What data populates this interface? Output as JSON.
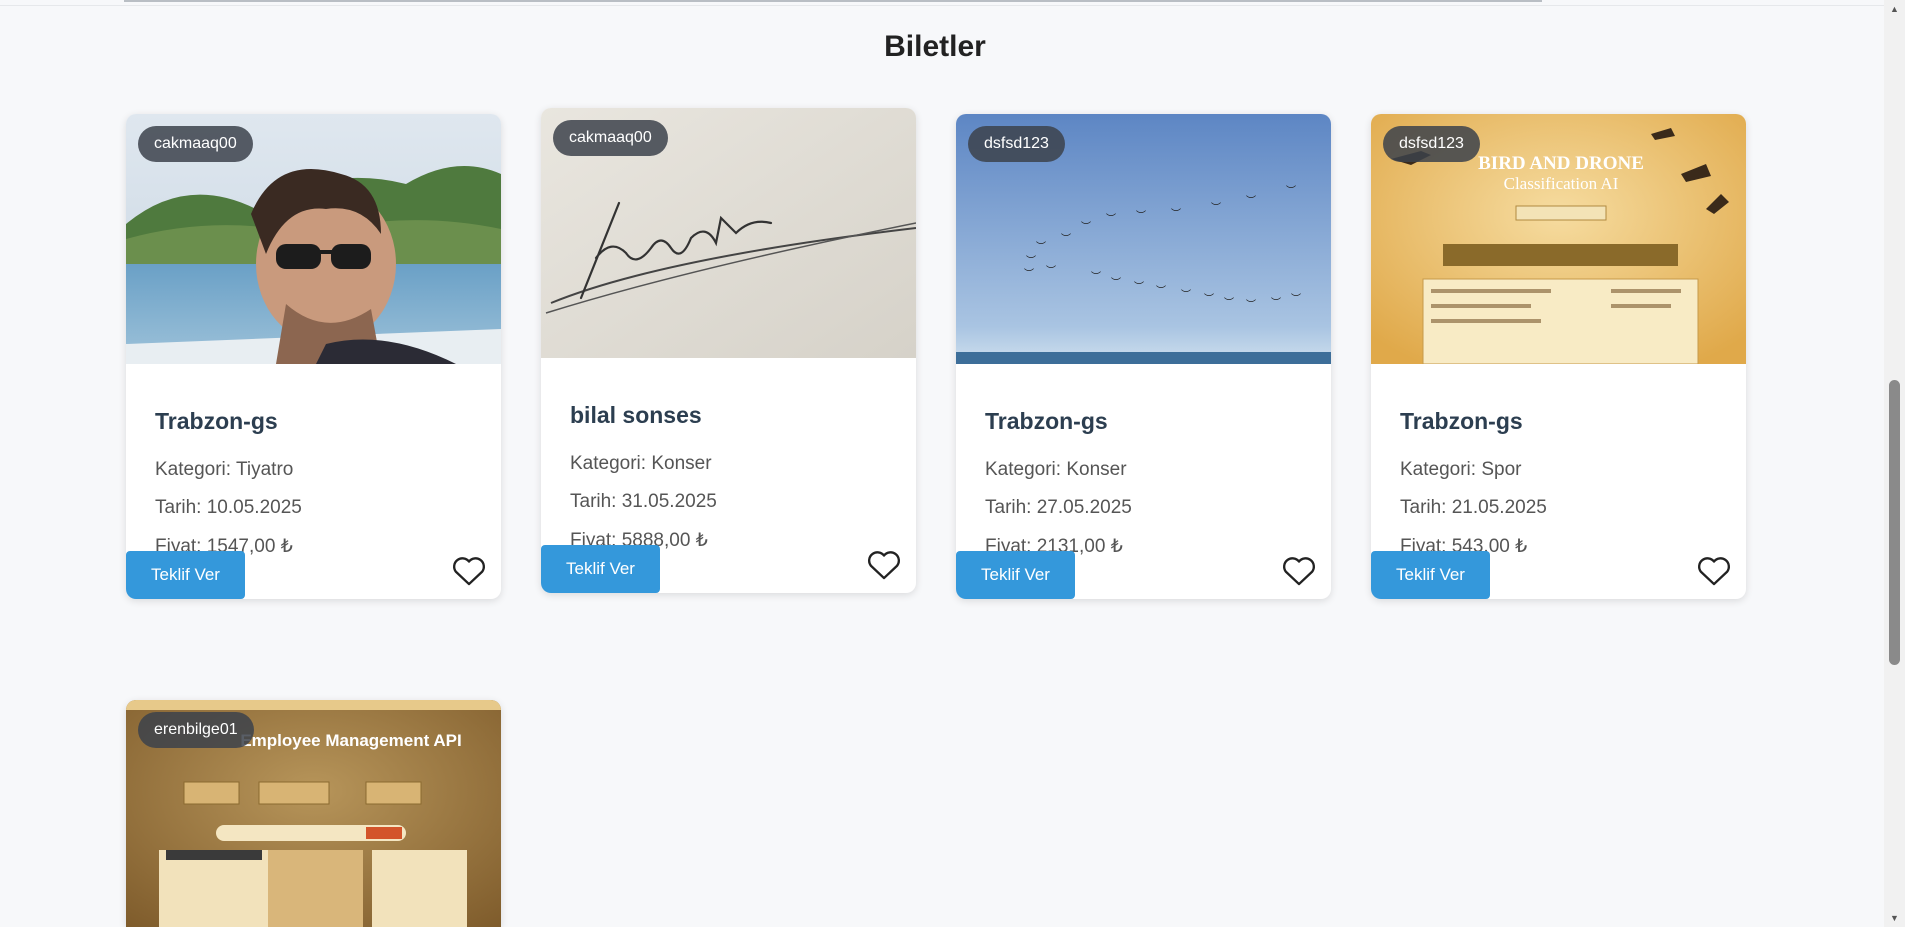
{
  "heading": "Biletler",
  "offer_label": "Teklif Ver",
  "tickets": [
    {
      "user": "cakmaaq00",
      "title": "Trabzon-gs",
      "category": "Kategori: Tiyatro",
      "date": "Tarih: 10.05.2025",
      "price": "Fiyat: 1547,00 ₺"
    },
    {
      "user": "cakmaaq00",
      "title": "bilal sonses",
      "category": "Kategori: Konser",
      "date": "Tarih: 31.05.2025",
      "price": "Fiyat: 5888,00 ₺"
    },
    {
      "user": "dsfsd123",
      "title": "Trabzon-gs",
      "category": "Kategori: Konser",
      "date": "Tarih: 27.05.2025",
      "price": "Fiyat: 2131,00 ₺"
    },
    {
      "user": "dsfsd123",
      "title": "Trabzon-gs",
      "category": "Kategori: Spor",
      "date": "Tarih: 21.05.2025",
      "price": "Fiyat: 543,00 ₺"
    },
    {
      "user": "erenbilge01"
    }
  ],
  "images": {
    "drone_title": "BIRD AND DRONE",
    "drone_subtitle": "Classification AI",
    "api_title": "Employee Management API"
  },
  "icons": {
    "heart": "heart-outline-icon"
  }
}
